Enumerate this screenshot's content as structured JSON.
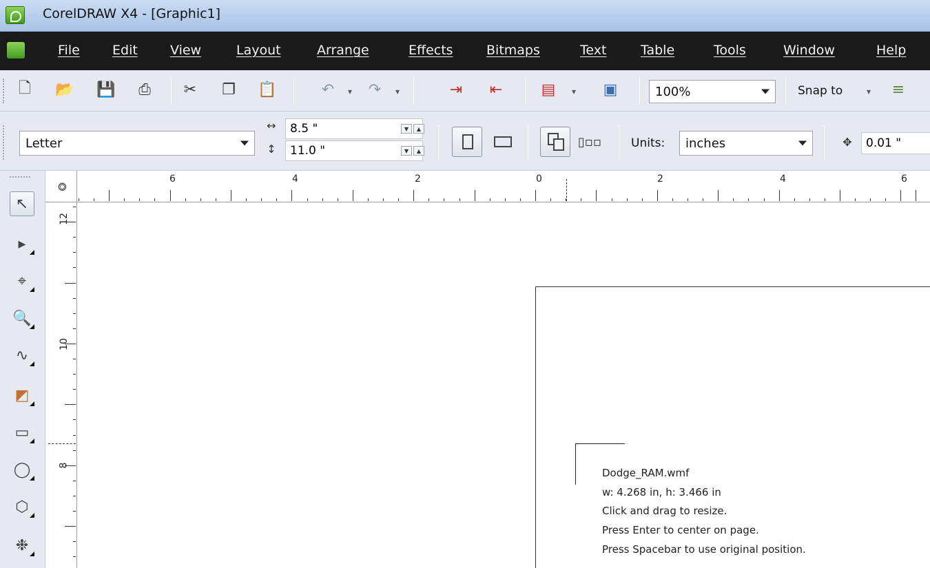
{
  "window": {
    "title": "CorelDRAW X4 - [Graphic1]"
  },
  "menu": [
    {
      "label": "File"
    },
    {
      "label": "Edit"
    },
    {
      "label": "View"
    },
    {
      "label": "Layout"
    },
    {
      "label": "Arrange"
    },
    {
      "label": "Effects"
    },
    {
      "label": "Bitmaps"
    },
    {
      "label": "Text"
    },
    {
      "label": "Table"
    },
    {
      "label": "Tools"
    },
    {
      "label": "Window"
    },
    {
      "label": "Help"
    }
  ],
  "standard_toolbar": {
    "zoom_value": "100%",
    "snap_label": "Snap to",
    "icons": [
      "new-icon",
      "open-icon",
      "save-icon",
      "print-icon",
      "cut-icon",
      "copy-icon",
      "paste-icon",
      "undo-icon",
      "redo-icon",
      "import-icon",
      "export-icon",
      "application-launcher-icon",
      "welcome-screen-icon",
      "options-icon"
    ]
  },
  "property_bar": {
    "paper_size": "Letter",
    "width": "8.5 \"",
    "height": "11.0 \"",
    "units_label": "Units:",
    "units_value": "inches",
    "nudge": "0.01 \""
  },
  "rulers": {
    "horizontal_labels": [
      "6",
      "4",
      "2",
      "0",
      "2",
      "4",
      "6"
    ],
    "vertical_labels": [
      "12",
      "10",
      "8"
    ]
  },
  "toolbox": [
    "pick-tool-icon",
    "shape-tool-icon",
    "crop-tool-icon",
    "zoom-tool-icon",
    "freehand-tool-icon",
    "smart-fill-tool-icon",
    "rectangle-tool-icon",
    "ellipse-tool-icon",
    "polygon-tool-icon",
    "basic-shapes-tool-icon"
  ],
  "import_tooltip": {
    "filename": "Dodge_RAM.wmf",
    "dimensions": "w: 4.268 in, h: 3.466 in",
    "hint1": "Click and drag to resize.",
    "hint2": "Press Enter to center on page.",
    "hint3": "Press Spacebar to use original position."
  }
}
